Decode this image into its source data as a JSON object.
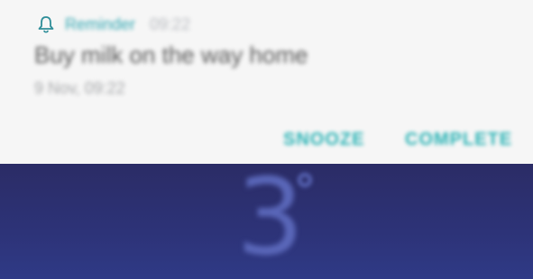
{
  "notification": {
    "app_name": "Reminder",
    "time": "09:22",
    "icon": "bell-icon",
    "title": "Buy milk on the way home",
    "subtitle": "9 Nov, 09:22",
    "actions": {
      "snooze": "SNOOZE",
      "complete": "COMPLETE"
    },
    "colors": {
      "accent": "#2ab3b5",
      "card_bg": "#f6f6f6"
    }
  },
  "background": {
    "weather_digit": "3",
    "degree_symbol_icon": "degree-icon",
    "color": "#2b2f6e"
  }
}
